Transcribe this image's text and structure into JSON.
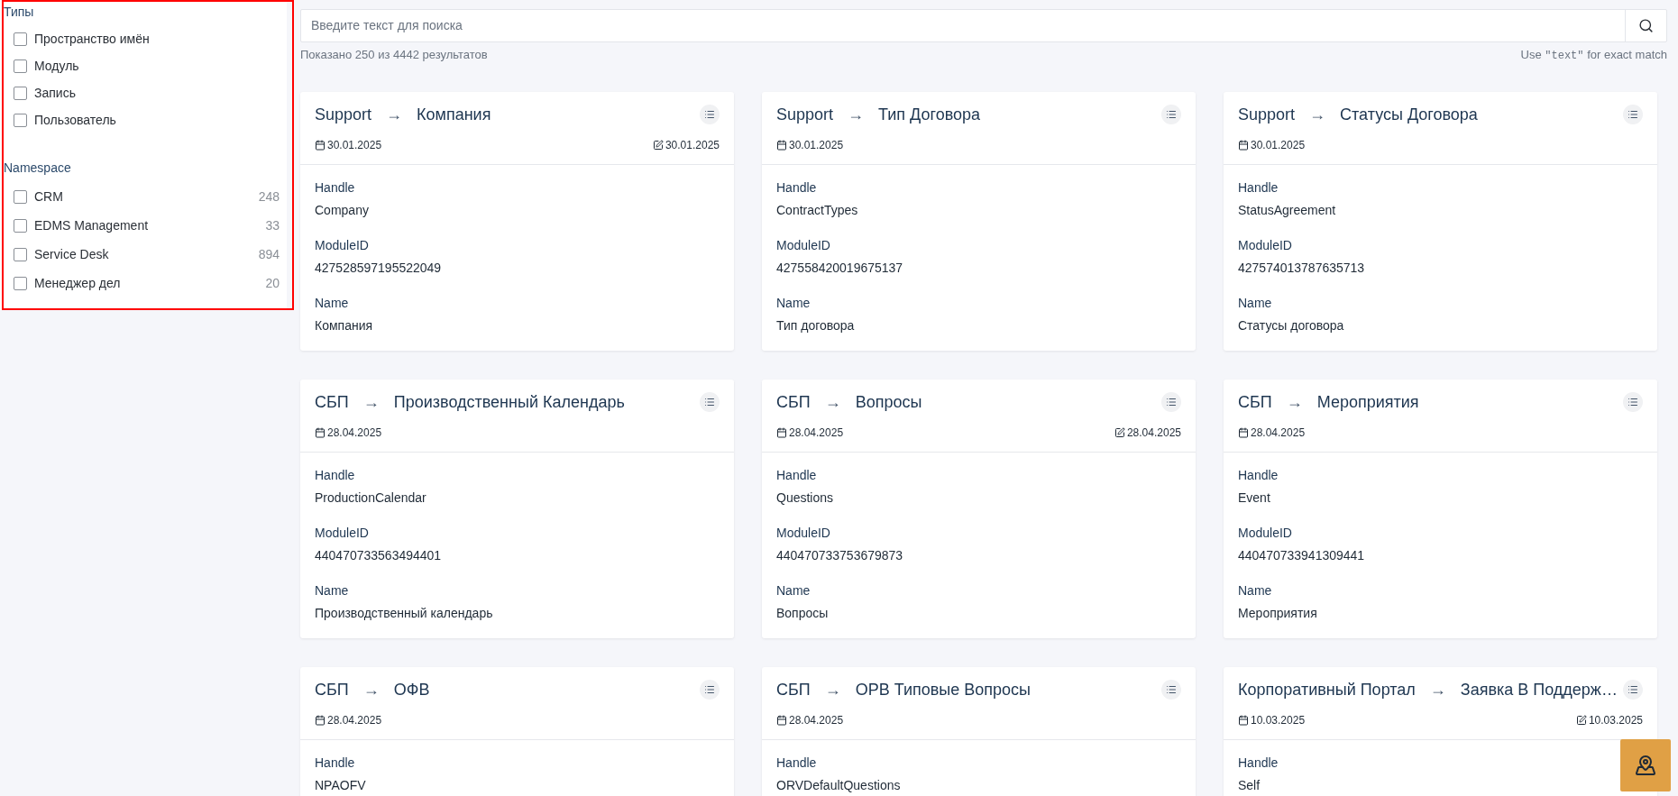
{
  "filters": {
    "groups": [
      {
        "title": "Типы",
        "items": [
          {
            "label": "Пространство имён",
            "checked": false
          },
          {
            "label": "Модуль",
            "checked": false
          },
          {
            "label": "Запись",
            "checked": false
          },
          {
            "label": "Пользователь",
            "checked": false
          }
        ]
      },
      {
        "title": "Namespace",
        "items": [
          {
            "label": "CRM",
            "count": "248",
            "checked": false
          },
          {
            "label": "EDMS Management",
            "count": "33",
            "checked": false
          },
          {
            "label": "Service Desk",
            "count": "894",
            "checked": false
          },
          {
            "label": "Менеджер дел",
            "count": "20",
            "checked": false
          }
        ]
      }
    ]
  },
  "search": {
    "placeholder": "Введите текст для поиска",
    "results": "Показано 250 из 4442 результатов",
    "hint_before": "Use",
    "hint_code": "\"text\"",
    "hint_after": "for exact match"
  },
  "cards": [
    {
      "source": "Support",
      "arrow": "→",
      "target": "Компания",
      "created": "30.01.2025",
      "modified": "30.01.2025",
      "fields": [
        {
          "label": "Handle",
          "value": "Company"
        },
        {
          "label": "ModuleID",
          "value": "427528597195522049"
        },
        {
          "label": "Name",
          "value": "Компания"
        }
      ]
    },
    {
      "source": "Support",
      "arrow": "→",
      "target": "Тип Договора",
      "created": "30.01.2025",
      "fields": [
        {
          "label": "Handle",
          "value": "ContractTypes"
        },
        {
          "label": "ModuleID",
          "value": "427558420019675137"
        },
        {
          "label": "Name",
          "value": "Тип договора"
        }
      ]
    },
    {
      "source": "Support",
      "arrow": "→",
      "target": "Статусы Договора",
      "created": "30.01.2025",
      "fields": [
        {
          "label": "Handle",
          "value": "StatusAgreement"
        },
        {
          "label": "ModuleID",
          "value": "427574013787635713"
        },
        {
          "label": "Name",
          "value": "Статусы договора"
        }
      ]
    },
    {
      "source": "СБП",
      "arrow": "→",
      "target": "Производственный Календарь",
      "created": "28.04.2025",
      "fields": [
        {
          "label": "Handle",
          "value": "ProductionCalendar"
        },
        {
          "label": "ModuleID",
          "value": "440470733563494401"
        },
        {
          "label": "Name",
          "value": "Производственный календарь"
        }
      ]
    },
    {
      "source": "СБП",
      "arrow": "→",
      "target": "Вопросы",
      "created": "28.04.2025",
      "modified": "28.04.2025",
      "fields": [
        {
          "label": "Handle",
          "value": "Questions"
        },
        {
          "label": "ModuleID",
          "value": "440470733753679873"
        },
        {
          "label": "Name",
          "value": "Вопросы"
        }
      ]
    },
    {
      "source": "СБП",
      "arrow": "→",
      "target": "Мероприятия",
      "created": "28.04.2025",
      "fields": [
        {
          "label": "Handle",
          "value": "Event"
        },
        {
          "label": "ModuleID",
          "value": "440470733941309441"
        },
        {
          "label": "Name",
          "value": "Мероприятия"
        }
      ]
    },
    {
      "source": "СБП",
      "arrow": "→",
      "target": "ОФВ",
      "created": "28.04.2025",
      "fields": [
        {
          "label": "Handle",
          "value": "NPAOFV"
        }
      ]
    },
    {
      "source": "СБП",
      "arrow": "→",
      "target": "ОРВ Типовые Вопросы",
      "created": "28.04.2025",
      "fields": [
        {
          "label": "Handle",
          "value": "ORVDefaultQuestions"
        }
      ]
    },
    {
      "source": "Корпоративный Портал",
      "arrow": "→",
      "target": "Заявка В Поддерж…",
      "created": "10.03.2025",
      "modified": "10.03.2025",
      "fields": [
        {
          "label": "Handle",
          "value": "Self"
        }
      ]
    }
  ]
}
